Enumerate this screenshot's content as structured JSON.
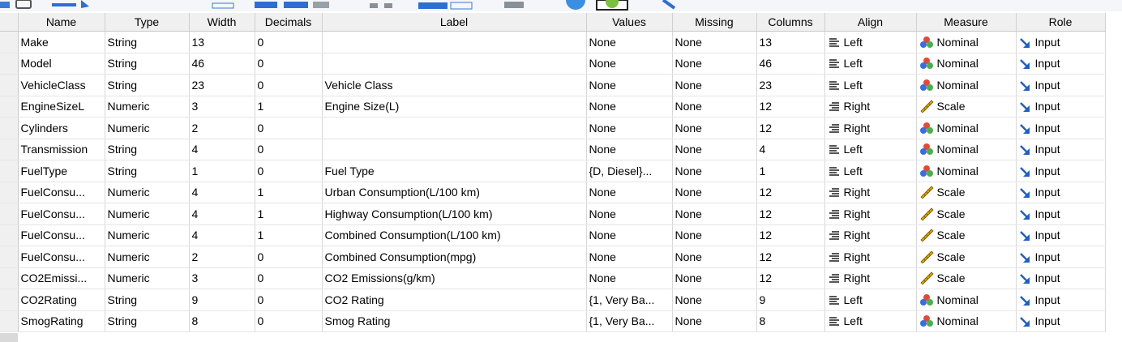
{
  "toolbar": {
    "icons": [
      "open-icon",
      "save-icon",
      "import-icon",
      "insert-cases-icon",
      "insert-variable-icon",
      "split-file-icon",
      "weight-cases-icon",
      "select-cases-icon",
      "value-labels-icon",
      "use-sets-icon",
      "spelling-icon",
      "script-icon"
    ]
  },
  "columns": {
    "name": "Name",
    "type": "Type",
    "width": "Width",
    "decimals": "Decimals",
    "label": "Label",
    "values": "Values",
    "missing": "Missing",
    "columns": "Columns",
    "align": "Align",
    "measure": "Measure",
    "role": "Role"
  },
  "rows": [
    {
      "name": "Make",
      "type": "String",
      "width": "13",
      "decimals": "0",
      "label": "",
      "values": "None",
      "missing": "None",
      "columns": "13",
      "align": "Left",
      "measure": "Nominal",
      "role": "Input"
    },
    {
      "name": "Model",
      "type": "String",
      "width": "46",
      "decimals": "0",
      "label": "",
      "values": "None",
      "missing": "None",
      "columns": "46",
      "align": "Left",
      "measure": "Nominal",
      "role": "Input"
    },
    {
      "name": "VehicleClass",
      "type": "String",
      "width": "23",
      "decimals": "0",
      "label": "Vehicle Class",
      "values": "None",
      "missing": "None",
      "columns": "23",
      "align": "Left",
      "measure": "Nominal",
      "role": "Input"
    },
    {
      "name": "EngineSizeL",
      "type": "Numeric",
      "width": "3",
      "decimals": "1",
      "label": "Engine Size(L)",
      "values": "None",
      "missing": "None",
      "columns": "12",
      "align": "Right",
      "measure": "Scale",
      "role": "Input"
    },
    {
      "name": "Cylinders",
      "type": "Numeric",
      "width": "2",
      "decimals": "0",
      "label": "",
      "values": "None",
      "missing": "None",
      "columns": "12",
      "align": "Right",
      "measure": "Nominal",
      "role": "Input"
    },
    {
      "name": "Transmission",
      "type": "String",
      "width": "4",
      "decimals": "0",
      "label": "",
      "values": "None",
      "missing": "None",
      "columns": "4",
      "align": "Left",
      "measure": "Nominal",
      "role": "Input"
    },
    {
      "name": "FuelType",
      "type": "String",
      "width": "1",
      "decimals": "0",
      "label": "Fuel Type",
      "values": "{D, Diesel}...",
      "missing": "None",
      "columns": "1",
      "align": "Left",
      "measure": "Nominal",
      "role": "Input"
    },
    {
      "name": "FuelConsu...",
      "type": "Numeric",
      "width": "4",
      "decimals": "1",
      "label": "Urban Consumption(L/100 km)",
      "values": "None",
      "missing": "None",
      "columns": "12",
      "align": "Right",
      "measure": "Scale",
      "role": "Input"
    },
    {
      "name": "FuelConsu...",
      "type": "Numeric",
      "width": "4",
      "decimals": "1",
      "label": "Highway Consumption(L/100 km)",
      "values": "None",
      "missing": "None",
      "columns": "12",
      "align": "Right",
      "measure": "Scale",
      "role": "Input"
    },
    {
      "name": "FuelConsu...",
      "type": "Numeric",
      "width": "4",
      "decimals": "1",
      "label": "Combined Consumption(L/100 km)",
      "values": "None",
      "missing": "None",
      "columns": "12",
      "align": "Right",
      "measure": "Scale",
      "role": "Input"
    },
    {
      "name": "FuelConsu...",
      "type": "Numeric",
      "width": "2",
      "decimals": "0",
      "label": "Combined Consumption(mpg)",
      "values": "None",
      "missing": "None",
      "columns": "12",
      "align": "Right",
      "measure": "Scale",
      "role": "Input"
    },
    {
      "name": "CO2Emissi...",
      "type": "Numeric",
      "width": "3",
      "decimals": "0",
      "label": "CO2 Emissions(g/km)",
      "values": "None",
      "missing": "None",
      "columns": "12",
      "align": "Right",
      "measure": "Scale",
      "role": "Input"
    },
    {
      "name": "CO2Rating",
      "type": "String",
      "width": "9",
      "decimals": "0",
      "label": "CO2 Rating",
      "values": "{1, Very Ba...",
      "missing": "None",
      "columns": "9",
      "align": "Left",
      "measure": "Nominal",
      "role": "Input"
    },
    {
      "name": "SmogRating",
      "type": "String",
      "width": "8",
      "decimals": "0",
      "label": "Smog Rating",
      "values": "{1, Very Ba...",
      "missing": "None",
      "columns": "8",
      "align": "Left",
      "measure": "Nominal",
      "role": "Input"
    }
  ],
  "colors": {
    "header_bg": "#f0f0f0",
    "role_arrow": "#1f5fbf",
    "scale_ruler": "#d9a300",
    "nominal_red": "#e04a3a",
    "nominal_blue": "#3a6fd8",
    "nominal_green": "#4cae4c"
  }
}
